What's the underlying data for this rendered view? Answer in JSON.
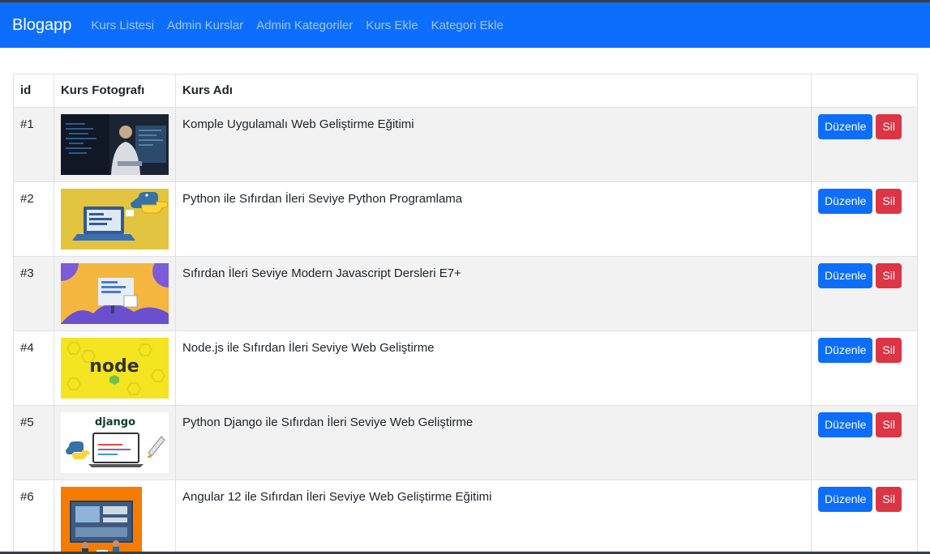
{
  "navbar": {
    "brand": "Blogapp",
    "links": [
      "Kurs Listesi",
      "Admin Kurslar",
      "Admin Kategoriler",
      "Kurs Ekle",
      "Kategori Ekle"
    ]
  },
  "table": {
    "headers": [
      "id",
      "Kurs Fotografı",
      "Kurs Adı",
      ""
    ],
    "rows": [
      {
        "id": "#1",
        "title": "Komple Uygulamalı Web Geliştirme Eğitimi"
      },
      {
        "id": "#2",
        "title": "Python ile Sıfırdan İleri Seviye Python Programlama"
      },
      {
        "id": "#3",
        "title": "Sıfırdan İleri Seviye Modern Javascript Dersleri E7+"
      },
      {
        "id": "#4",
        "title": "Node.js ile Sıfırdan İleri Seviye Web Geliştirme"
      },
      {
        "id": "#5",
        "title": "Python Django ile Sıfırdan İleri Seviye Web Geliştirme"
      },
      {
        "id": "#6",
        "title": "Angular 12 ile Sıfırdan İleri Seviye Web Geliştirme Eğitimi"
      }
    ],
    "edit_label": "Düzenle",
    "delete_label": "Sil"
  },
  "images": {
    "node_text": "node",
    "django_text": "django"
  },
  "colors": {
    "primary": "#0d6efd",
    "danger": "#dc3545",
    "stripe": "#f2f2f2"
  }
}
